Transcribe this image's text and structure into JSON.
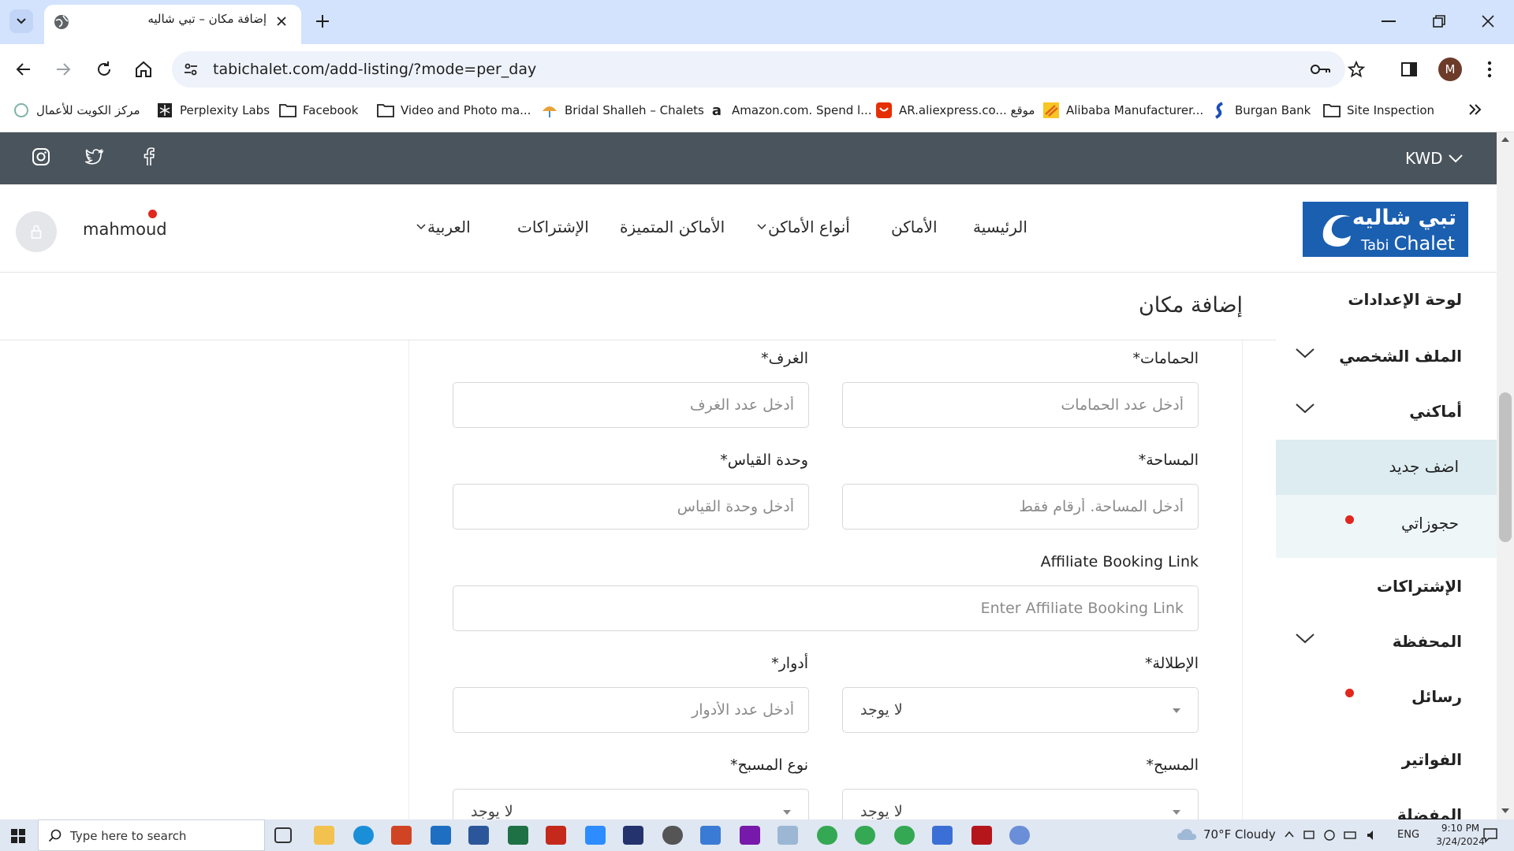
{
  "browser": {
    "tab_title": "إضافة مكان – تبي شاليه",
    "url": "tabichalet.com/add-listing/?mode=per_day",
    "profile_initial": "M",
    "bookmarks": [
      "مركز الكويت للأعمال",
      "Perplexity Labs",
      "Facebook",
      "Video and Photo ma...",
      "Bridal Shalleh – Chalets",
      "Amazon.com. Spend l...",
      "AR.aliexpress.co... موقع",
      "Alibaba Manufacturer...",
      "Burgan Bank",
      "Site Inspection"
    ]
  },
  "site": {
    "currency": "KWD",
    "logo": {
      "ar": "تبي شاليه",
      "en_small": "Tabi",
      "en_big": "Chalet"
    },
    "nav": {
      "home": "الرئيسية",
      "places": "الأماكن",
      "place_types": "أنواع الأماكن",
      "featured": "الأماكن المتميزة",
      "subscriptions": "الإشتراكات",
      "language": "العربية"
    },
    "username": "mahmoud",
    "page_title": "إضافة مكان",
    "sidebar": {
      "dashboard": "لوحة الإعدادات",
      "profile": "الملف الشخصي",
      "my_places": "أماكني",
      "add_new": "اضف جديد",
      "my_bookings": "حجوزاتي",
      "subscriptions": "الإشتراكات",
      "wallet": "المحفظة",
      "messages": "رسائل",
      "invoices": "الفواتير",
      "favorites": "المفضلة"
    },
    "form": {
      "bathrooms_label": "الحمامات*",
      "bathrooms_placeholder": "أدخل عدد الحمامات",
      "rooms_label": "الغرف*",
      "rooms_placeholder": "أدخل عدد الغرف",
      "area_label": "المساحة*",
      "area_placeholder": "أدخل المساحة. أرقام فقط",
      "unit_label": "وحدة القياس*",
      "unit_placeholder": "أدخل وحدة القياس",
      "affiliate_label": "Affiliate Booking Link",
      "affiliate_placeholder": "Enter Affiliate Booking Link",
      "view_label": "الإطلالة*",
      "view_value": "لا يوجد",
      "floors_label": "أدوار*",
      "floors_placeholder": "أدخل عدد الأدوار",
      "pool_label": "المسبح*",
      "pool_value": "لا يوجد",
      "pool_type_label": "نوع المسبح*",
      "pool_type_value": "لا يوجد"
    }
  },
  "taskbar": {
    "search_placeholder": "Type here to search",
    "weather": "70°F  Cloudy",
    "lang": "ENG",
    "time": "9:10 PM",
    "date": "3/24/2024"
  }
}
